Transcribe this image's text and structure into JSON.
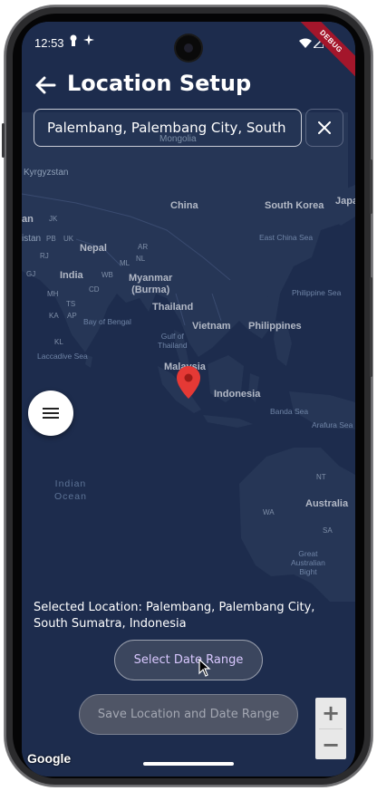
{
  "status_bar": {
    "time": "12:53",
    "debug_label": "DEBUG"
  },
  "header": {
    "back_icon": "arrow-left-icon",
    "title": "Location Setup"
  },
  "search": {
    "value": "Palembang, Palembang City, South",
    "clear_icon": "close-icon"
  },
  "map": {
    "labels": {
      "mongolia": "Mongolia",
      "kyrgyzstan": "Kyrgyzstan",
      "china": "China",
      "south_korea": "South Korea",
      "japan": "Japa",
      "jk": "JK",
      "an": "an",
      "istan": "istan",
      "pb": "PB",
      "uk": "UK",
      "nepal": "Nepal",
      "ar": "AR",
      "rj": "RJ",
      "nl": "NL",
      "ml": "ML",
      "gj": "GJ",
      "india": "India",
      "wb": "WB",
      "myanmar": "Myanmar\n(Burma)",
      "mh": "MH",
      "cd": "CD",
      "ts": "TS",
      "ka": "KA",
      "ap": "AP",
      "bay_of_bengal": "Bay of Bengal",
      "thailand": "Thailand",
      "kl": "KL",
      "gulf_of_thailand": "Gulf of\nThailand",
      "vietnam": "Vietnam",
      "philippines": "Philippines",
      "laccadive_sea": "Laccadive Sea",
      "east_china_sea": "East China Sea",
      "philippine_sea": "Philippine Sea",
      "malaysia": "Malaysia",
      "indonesia": "Indonesia",
      "banda_sea": "Banda Sea",
      "arafura_sea": "Arafura Sea",
      "nt": "NT",
      "australia": "Australia",
      "wa": "WA",
      "sa": "SA",
      "great_australian_bight": "Great\nAustralian\nBight",
      "indian_ocean": "Indian\nOcean"
    },
    "marker_icon": "map-pin-icon",
    "menu_icon": "menu-icon",
    "zoom_in": "+",
    "zoom_out": "−",
    "attribution": "Google"
  },
  "selected_location": "Selected Location: Palembang, Palembang City, South Sumatra, Indonesia",
  "buttons": {
    "select_date": "Select Date Range",
    "save": "Save Location and Date Range"
  }
}
